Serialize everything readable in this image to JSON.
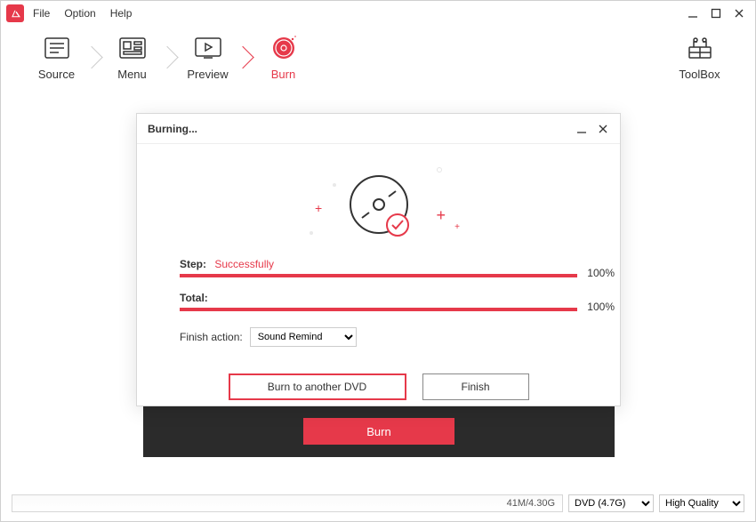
{
  "menu": {
    "file": "File",
    "option": "Option",
    "help": "Help"
  },
  "tabs": {
    "source": "Source",
    "menu": "Menu",
    "preview": "Preview",
    "burn": "Burn",
    "toolbox": "ToolBox"
  },
  "burn_button": "Burn",
  "modal": {
    "title": "Burning...",
    "step_label": "Step:",
    "step_value": "Successfully",
    "step_pct": "100%",
    "total_label": "Total:",
    "total_pct": "100%",
    "finish_action_label": "Finish action:",
    "finish_action_value": "Sound Remind",
    "burn_another": "Burn to another DVD",
    "finish": "Finish"
  },
  "footer": {
    "size": "41M/4.30G",
    "disc_type": "DVD (4.7G)",
    "quality": "High Quality"
  },
  "colors": {
    "accent": "#e6394a"
  }
}
